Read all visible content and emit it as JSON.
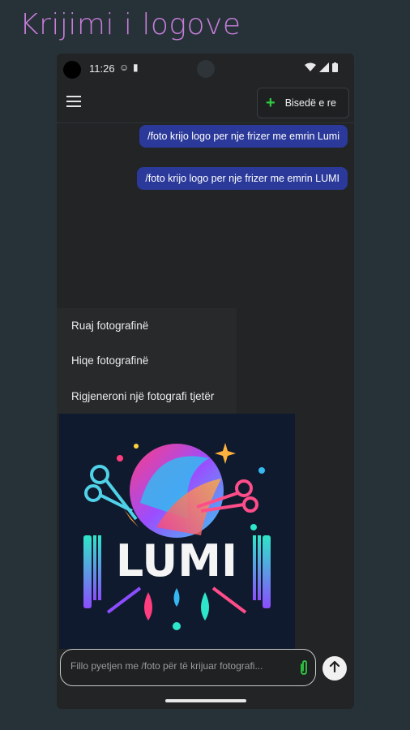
{
  "promo": {
    "title": "Krijimi i logove"
  },
  "statusbar": {
    "time": "11:26"
  },
  "appbar": {
    "new_chat_label": "Bisedë e re"
  },
  "messages": [
    {
      "text": "/foto krijo logo per nje frizer me emrin Lumi"
    },
    {
      "text": "/foto krijo logo per nje frizer me emrin LUMI"
    }
  ],
  "context_menu": {
    "items": [
      {
        "label": "Ruaj fotografinë"
      },
      {
        "label": "Hiqe fotografinë"
      },
      {
        "label": "Rigjeneroni një fotografi tjetër"
      }
    ]
  },
  "generated_image": {
    "logo_text": "LUMI"
  },
  "composer": {
    "placeholder": "Fillo pyetjen me /foto për të krijuar fotografi..."
  },
  "icons": {
    "menu": "hamburger-menu-icon",
    "new_chat": "plus-icon",
    "attach": "paperclip-icon",
    "send": "arrow-up-icon"
  },
  "colors": {
    "accent_green": "#2ecc40",
    "bubble": "#2b3a9a",
    "title": "#c77dd9"
  }
}
